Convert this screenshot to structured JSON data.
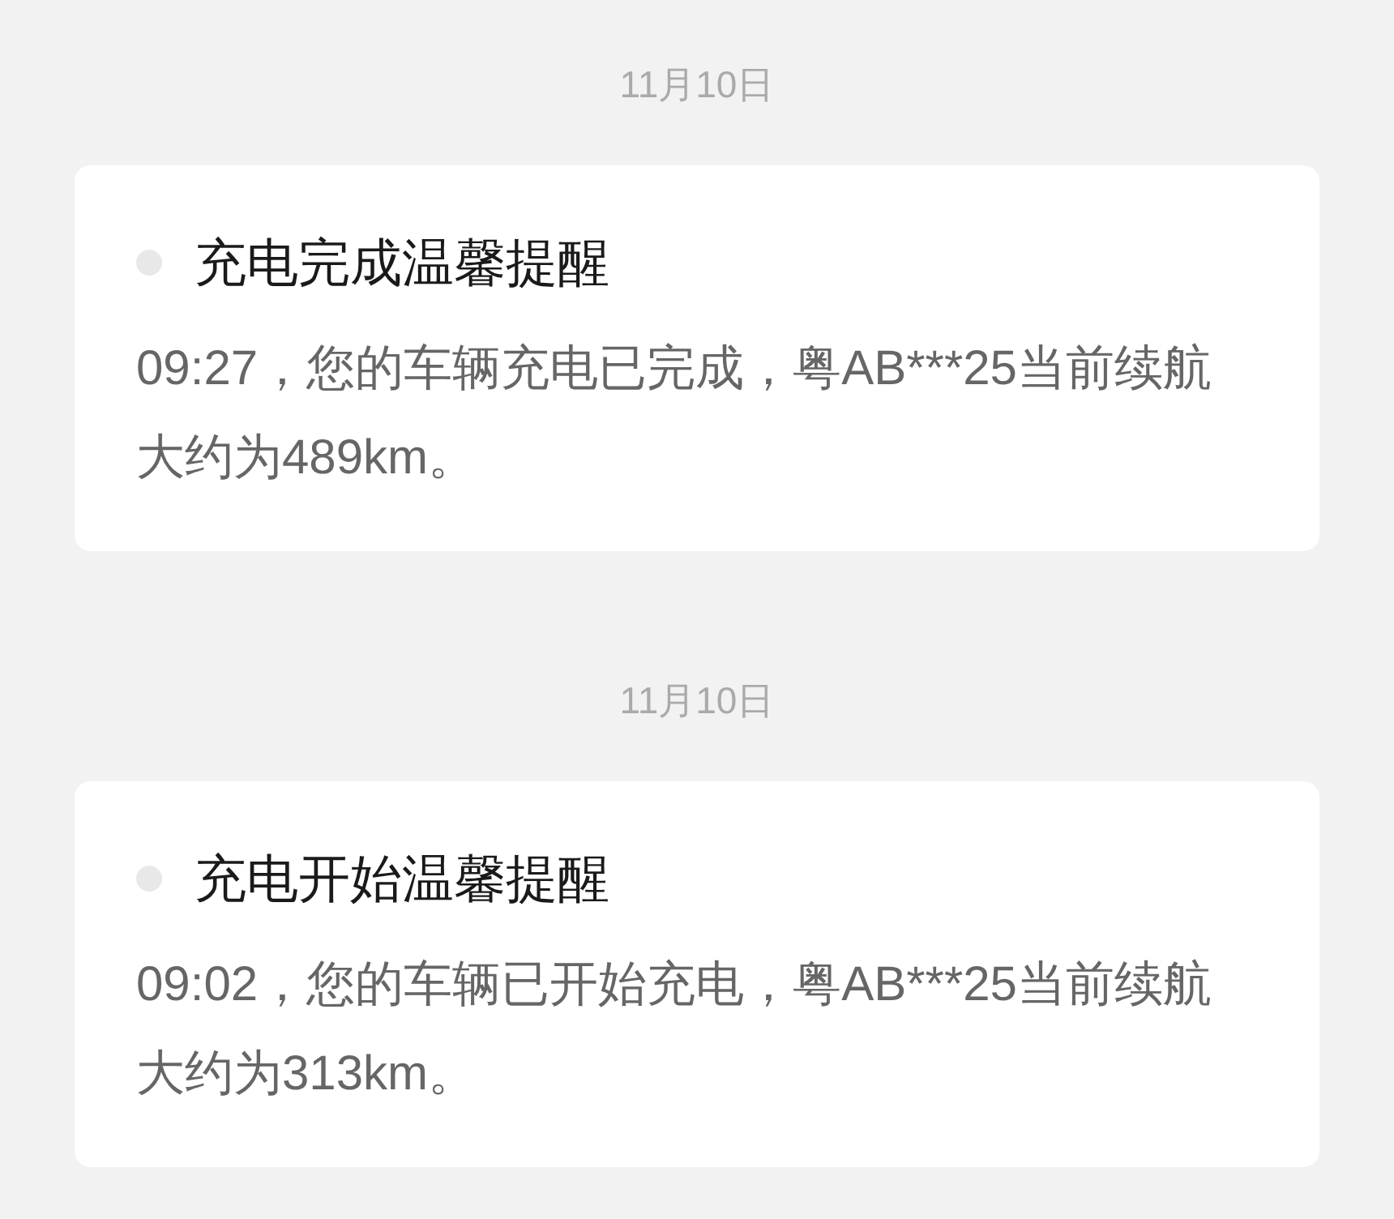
{
  "messages": [
    {
      "date": "11月10日",
      "title": "充电完成温馨提醒",
      "body": "09:27，您的车辆充电已完成，粤AB***25当前续航大约为489km。"
    },
    {
      "date": "11月10日",
      "title": "充电开始温馨提醒",
      "body": "09:02，您的车辆已开始充电，粤AB***25当前续航大约为313km。"
    }
  ]
}
